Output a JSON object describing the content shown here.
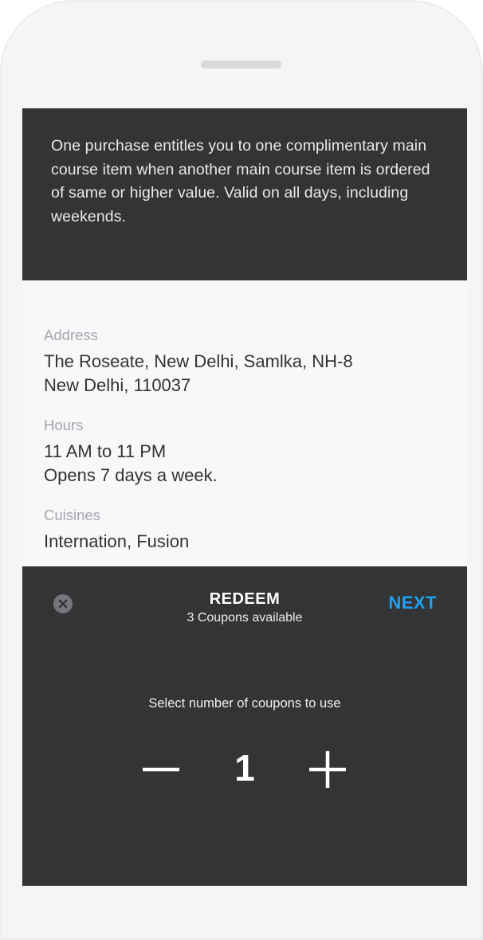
{
  "offer": {
    "description": "One purchase entitles you to one complimentary main course item when another main course item is ordered of same or higher value. Valid on all days, including weekends."
  },
  "details": {
    "address": {
      "label": "Address",
      "line1": "The Roseate, New Delhi, Samlka, NH-8",
      "line2": "New Delhi, 110037"
    },
    "hours": {
      "label": "Hours",
      "line1": "11 AM to 11 PM",
      "line2": "Opens 7 days a week."
    },
    "cuisines": {
      "label": "Cuisines",
      "value": "Internation, Fusion"
    }
  },
  "redeem": {
    "title": "REDEEM",
    "subtitle": "3 Coupons available",
    "next_label": "NEXT",
    "select_label": "Select number of coupons to use",
    "count": "1",
    "icons": {
      "close": "close-circle-icon",
      "minus": "minus-icon",
      "plus": "plus-icon"
    }
  },
  "colors": {
    "dark_panel": "#333435",
    "accent": "#1da1f2",
    "info_background": "#f7f8fa",
    "label_gray": "#a4a6aa"
  }
}
